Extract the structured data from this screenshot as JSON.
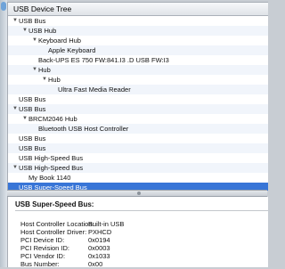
{
  "tree": {
    "header": "USB Device Tree",
    "rows": [
      {
        "label": "USB Bus",
        "indent": 0,
        "expanded": true
      },
      {
        "label": "USB Hub",
        "indent": 1,
        "expanded": true
      },
      {
        "label": "Keyboard Hub",
        "indent": 2,
        "expanded": true
      },
      {
        "label": "Apple Keyboard",
        "indent": 3,
        "expanded": null
      },
      {
        "label": "Back-UPS ES 750 FW:841.I3 .D USB FW:I3",
        "indent": 2,
        "expanded": null
      },
      {
        "label": "Hub",
        "indent": 2,
        "expanded": true
      },
      {
        "label": "Hub",
        "indent": 3,
        "expanded": true
      },
      {
        "label": "Ultra Fast Media Reader",
        "indent": 4,
        "expanded": null
      },
      {
        "label": "USB Bus",
        "indent": 0,
        "expanded": null
      },
      {
        "label": "USB Bus",
        "indent": 0,
        "expanded": true
      },
      {
        "label": "BRCM2046 Hub",
        "indent": 1,
        "expanded": true
      },
      {
        "label": "Bluetooth USB Host Controller",
        "indent": 2,
        "expanded": null
      },
      {
        "label": "USB Bus",
        "indent": 0,
        "expanded": null
      },
      {
        "label": "USB Bus",
        "indent": 0,
        "expanded": null
      },
      {
        "label": "USB High-Speed Bus",
        "indent": 0,
        "expanded": null
      },
      {
        "label": "USB High-Speed Bus",
        "indent": 0,
        "expanded": true
      },
      {
        "label": "My Book 1140",
        "indent": 1,
        "expanded": null
      },
      {
        "label": "USB Super-Speed Bus",
        "indent": 0,
        "expanded": null,
        "selected": true
      }
    ]
  },
  "detail": {
    "title": "USB Super-Speed Bus:",
    "properties": [
      {
        "label": "Host Controller Location:",
        "value": "Built-in USB"
      },
      {
        "label": "Host Controller Driver:",
        "value": "PXHCD"
      },
      {
        "label": "PCI Device ID:",
        "value": "0x0194"
      },
      {
        "label": "PCI Revision ID:",
        "value": "0x0003"
      },
      {
        "label": "PCI Vendor ID:",
        "value": "0x1033"
      },
      {
        "label": "Bus Number:",
        "value": "0x00"
      }
    ]
  },
  "colors": {
    "selection": "#3875d7",
    "alt_row": "#f1f5fb"
  },
  "icons": {
    "expanded": "disclosure-triangle-down-icon"
  }
}
